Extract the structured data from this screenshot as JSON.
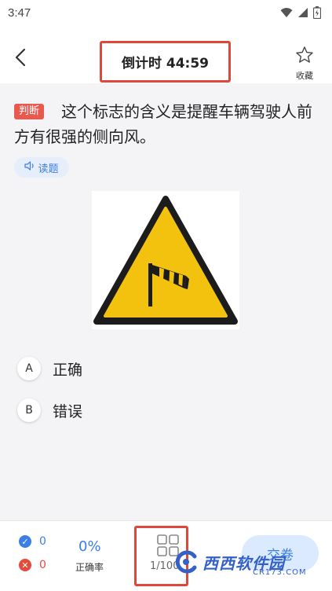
{
  "status_bar": {
    "time": "3:47",
    "icons": [
      "wifi-icon",
      "signal-icon",
      "battery-icon"
    ]
  },
  "header": {
    "back_icon": "chevron-left-icon",
    "timer_label": "倒计时 44:59",
    "favorite_icon": "star-outline-icon",
    "favorite_label": "收藏"
  },
  "question": {
    "tag": "判断",
    "text": "这个标志的含义是提醒车辆驾驶人前方有很强的侧向风。",
    "read_label": "读题",
    "read_icon": "speaker-icon",
    "image_icon": "crosswind-warning-sign"
  },
  "options": [
    {
      "letter": "A",
      "text": "正确"
    },
    {
      "letter": "B",
      "text": "错误"
    }
  ],
  "bottom": {
    "correct_count": "0",
    "wrong_count": "0",
    "rate_value": "0%",
    "rate_label": "正确率",
    "progress": "1/100",
    "submit_label": "交卷",
    "grid_icon": "grid-icon"
  },
  "watermark": {
    "text": "西西软件园",
    "sub": "CR173.COM"
  },
  "colors": {
    "accent": "#3a7ee6",
    "error": "#e64a3d",
    "tag": "#e85a4f",
    "highlight_border": "#e0473a",
    "sign_yellow": "#f2c20f"
  }
}
